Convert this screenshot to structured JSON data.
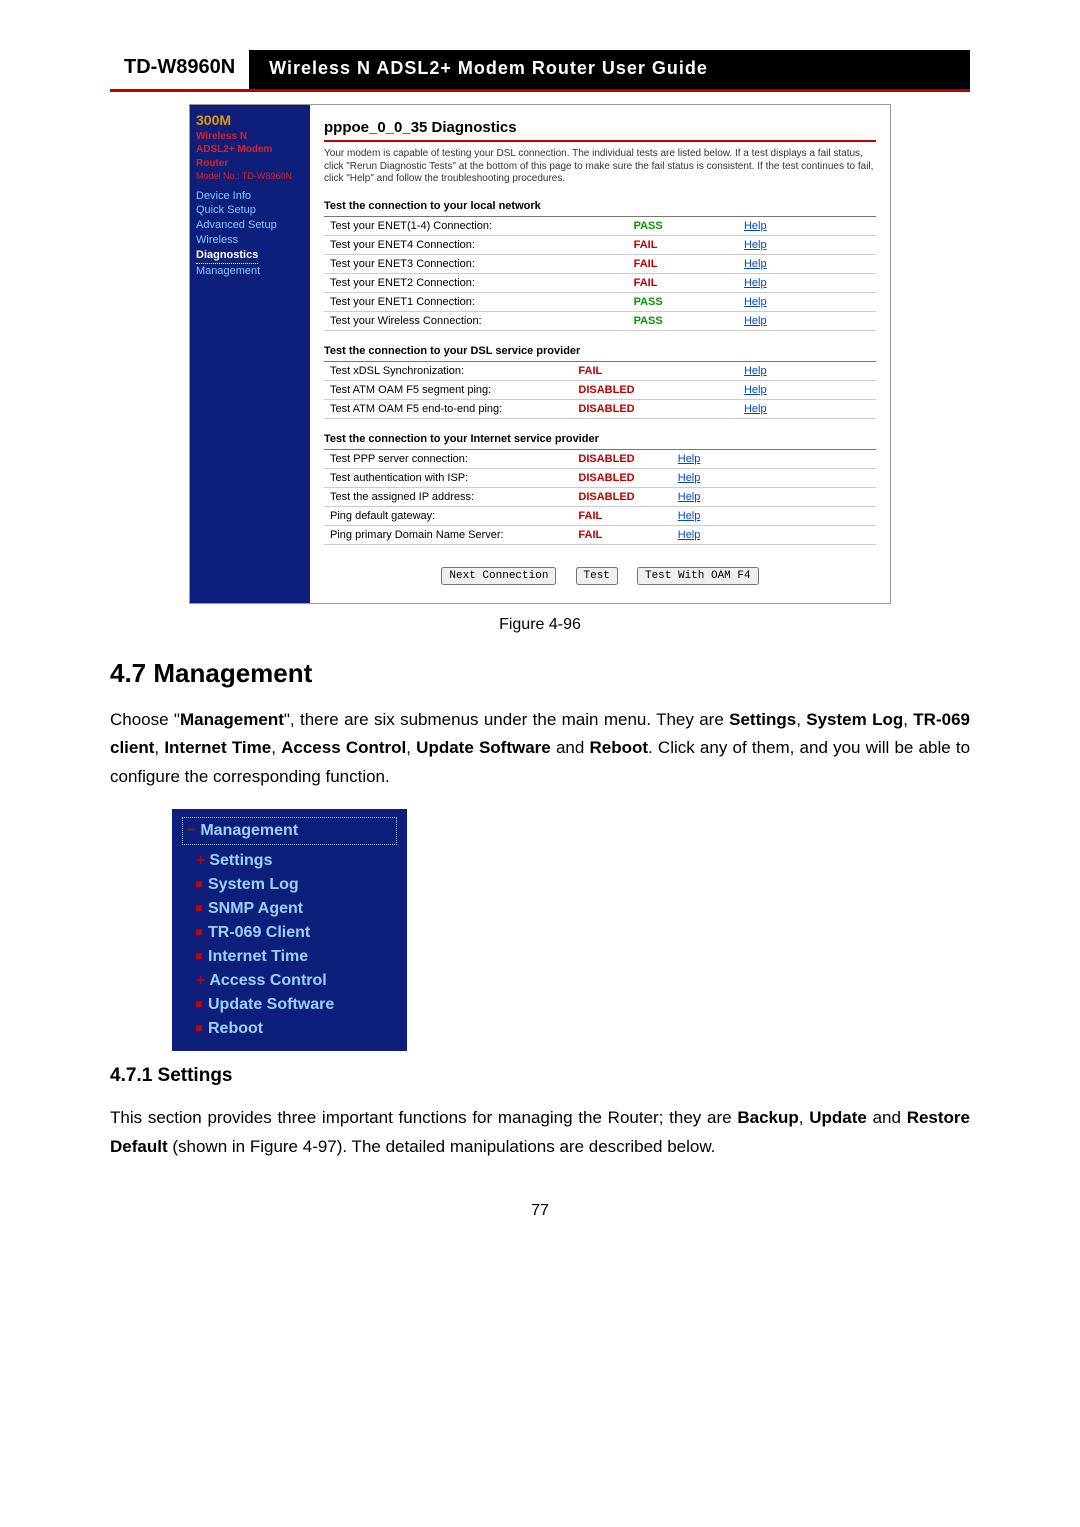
{
  "runhead": {
    "model": "TD-W8960N",
    "title": "Wireless N ADSL2+ Modem Router User Guide"
  },
  "shot1": {
    "side": {
      "brand": "300M",
      "sub1": "Wireless N",
      "sub2": "ADSL2+ Modem Router",
      "modelno": "Model No.: TD-W8960N",
      "nav": [
        "Device Info",
        "Quick Setup",
        "Advanced Setup",
        "Wireless",
        "Diagnostics",
        "Management"
      ]
    },
    "title": "pppoe_0_0_35 Diagnostics",
    "intro": "Your modem is capable of testing your DSL connection. The individual tests are listed below. If a test displays a fail status, click \"Rerun Diagnostic Tests\" at the bottom of this page to make sure the fail status is consistent. If the test continues to fail, click \"Help\" and follow the troubleshooting procedures.",
    "t1cap": "Test the connection to your local network",
    "t1": [
      {
        "name": "Test your ENET(1-4) Connection:",
        "status": "PASS",
        "help": "Help"
      },
      {
        "name": "Test your ENET4 Connection:",
        "status": "FAIL",
        "help": "Help"
      },
      {
        "name": "Test your ENET3 Connection:",
        "status": "FAIL",
        "help": "Help"
      },
      {
        "name": "Test your ENET2 Connection:",
        "status": "FAIL",
        "help": "Help"
      },
      {
        "name": "Test your ENET1 Connection:",
        "status": "PASS",
        "help": "Help"
      },
      {
        "name": "Test your Wireless Connection:",
        "status": "PASS",
        "help": "Help"
      }
    ],
    "t2cap": "Test the connection to your DSL service provider",
    "t2": [
      {
        "name": "Test xDSL Synchronization:",
        "status": "FAIL",
        "help": "Help"
      },
      {
        "name": "Test ATM OAM F5 segment ping:",
        "status": "DISABLED",
        "help": "Help"
      },
      {
        "name": "Test ATM OAM F5 end-to-end ping:",
        "status": "DISABLED",
        "help": "Help"
      }
    ],
    "t3cap": "Test the connection to your Internet service provider",
    "t3": [
      {
        "name": "Test PPP server connection:",
        "status": "DISABLED",
        "help": "Help"
      },
      {
        "name": "Test authentication with ISP:",
        "status": "DISABLED",
        "help": "Help"
      },
      {
        "name": "Test the assigned IP address:",
        "status": "DISABLED",
        "help": "Help"
      },
      {
        "name": "Ping default gateway:",
        "status": "FAIL",
        "help": "Help"
      },
      {
        "name": "Ping primary Domain Name Server:",
        "status": "FAIL",
        "help": "Help"
      }
    ],
    "btn1": "Next Connection",
    "btn2": "Test",
    "btn3": "Test With OAM F4"
  },
  "figcap1": "Figure 4-96",
  "sec47": "4.7  Management",
  "para1a": "Choose \"",
  "para1b": "Management",
  "para1c": "\", there are six submenus under the main menu. They are ",
  "para1d": "Settings",
  "para1e": ", ",
  "para1f": "System Log",
  "para1g": ", ",
  "para1h": "TR-069 client",
  "para1i": ", ",
  "para1j": "Internet Time",
  "para1k": ", ",
  "para1l": "Access Control",
  "para1m": ", ",
  "para1n": "Update Software",
  "para1o": " and ",
  "para1p": "Reboot",
  "para1q": ". Click any of them, and you will be able to configure the corresponding function.",
  "shot2": {
    "top": "Management",
    "items": [
      {
        "sym": "+",
        "label": "Settings"
      },
      {
        "sym": "•",
        "label": "System Log"
      },
      {
        "sym": "•",
        "label": "SNMP Agent"
      },
      {
        "sym": "•",
        "label": "TR-069 Client"
      },
      {
        "sym": "•",
        "label": "Internet Time"
      },
      {
        "sym": "+",
        "label": "Access Control"
      },
      {
        "sym": "•",
        "label": "Update Software"
      },
      {
        "sym": "•",
        "label": "Reboot"
      }
    ]
  },
  "sec471": "4.7.1  Settings",
  "para2a": "This section provides three important functions for managing the Router; they are ",
  "para2b": "Backup",
  "para2c": ", ",
  "para2d": "Update",
  "para2e": " and ",
  "para2f": "Restore Default",
  "para2g": " (shown in Figure 4-97). The detailed manipulations are described below.",
  "pagenum": "77"
}
